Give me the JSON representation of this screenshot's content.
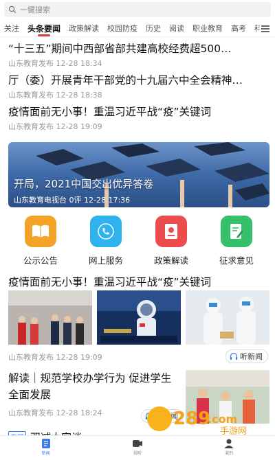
{
  "search": {
    "placeholder": "一键搜索"
  },
  "tabs": [
    "关注",
    "头条要闻",
    "政策解读",
    "校园防疫",
    "历史",
    "阅读",
    "职业教育",
    "高考",
    "科普"
  ],
  "active_tab": "头条要闻",
  "news_top": [
    {
      "title": "“十三五”期间中西部省部共建高校经费超500…",
      "meta": "山东教育发布 12-28 18:34"
    },
    {
      "title": "厅（委）开展青年干部党的十九届六中全会精神…",
      "meta": "山东教育发布 12-28 18:38"
    },
    {
      "title": "疫情面前无小事！重温习近平战“疫”关键词",
      "meta": "山东教育发布 12-28 19:09"
    }
  ],
  "banner": {
    "title": "开局，2021中国交出优异答卷",
    "meta": "山东教育电视台 0评 12-28 17:36"
  },
  "services": [
    {
      "label": "公示公告",
      "icon": "book-icon",
      "color": "#f4a329"
    },
    {
      "label": "网上服务",
      "icon": "phone-icon",
      "color": "#2fb3ee"
    },
    {
      "label": "政策解读",
      "icon": "document-icon",
      "color": "#ea4d4b"
    },
    {
      "label": "征求意见",
      "icon": "edit-icon",
      "color": "#35c16a"
    }
  ],
  "photo_news": {
    "title": "疫情面前无小事！重温习近平战“疫”关键词",
    "meta": "山东教育发布 12-28 19:09",
    "listen": "听新闻"
  },
  "image_news": {
    "title": "解读｜规范学校办学行为 促进学生全面发展",
    "meta": "山东教育发布 12-28 18:24",
    "listen": "听新闻"
  },
  "partial_item": {
    "tag": "专题",
    "title": "双减大家谈"
  },
  "bottom_nav": [
    {
      "label": "新闻",
      "icon": "news-icon",
      "active": true
    },
    {
      "label": "视听",
      "icon": "video-icon",
      "active": false
    },
    {
      "label": "我的",
      "icon": "user-icon",
      "active": false
    }
  ],
  "watermark": {
    "text1": "289",
    "text2": ".com",
    "text3": "手游网"
  },
  "colors": {
    "accent": "#e03a2e",
    "nav_active": "#3d7be8"
  }
}
